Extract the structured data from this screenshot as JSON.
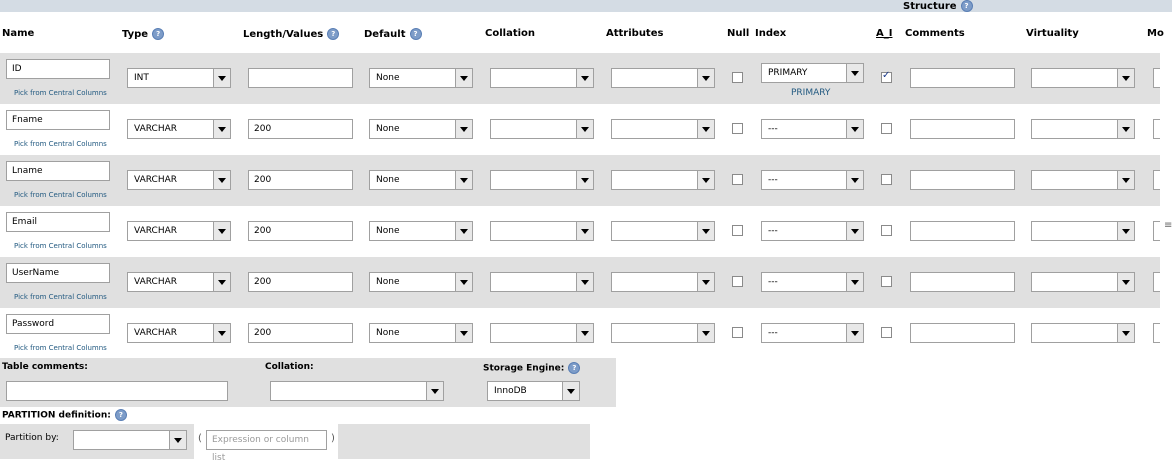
{
  "section": {
    "title": "Structure"
  },
  "columns": {
    "name": "Name",
    "type": "Type",
    "length": "Length/Values",
    "default": "Default",
    "collation": "Collation",
    "attributes": "Attributes",
    "null": "Null",
    "index": "Index",
    "ai": "A_I",
    "comments": "Comments",
    "virtuality": "Virtuality",
    "more": "Mo"
  },
  "pick_label": "Pick from Central Columns",
  "rows": [
    {
      "name": "ID",
      "type": "INT",
      "length": "",
      "default": "None",
      "index": "PRIMARY",
      "index_note": "PRIMARY",
      "ai": true
    },
    {
      "name": "Fname",
      "type": "VARCHAR",
      "length": "200",
      "default": "None",
      "index": "---",
      "ai": false
    },
    {
      "name": "Lname",
      "type": "VARCHAR",
      "length": "200",
      "default": "None",
      "index": "---",
      "ai": false
    },
    {
      "name": "Email",
      "type": "VARCHAR",
      "length": "200",
      "default": "None",
      "index": "---",
      "ai": false
    },
    {
      "name": "UserName",
      "type": "VARCHAR",
      "length": "200",
      "default": "None",
      "index": "---",
      "ai": false
    },
    {
      "name": "Password",
      "type": "VARCHAR",
      "length": "200",
      "default": "None",
      "index": "---",
      "ai": false
    }
  ],
  "table_options": {
    "comments_label": "Table comments:",
    "collation_label": "Collation:",
    "engine_label": "Storage Engine:",
    "engine_value": "InnoDB"
  },
  "partition": {
    "title": "PARTITION definition:",
    "by_label": "Partition by:",
    "expr_placeholder": "Expression or column list",
    "open_paren": "(",
    "close_paren": ")"
  },
  "colors": {
    "row_alt": "#e0e0e0",
    "link": "#235a81",
    "top_bar": "#d4dce4"
  }
}
